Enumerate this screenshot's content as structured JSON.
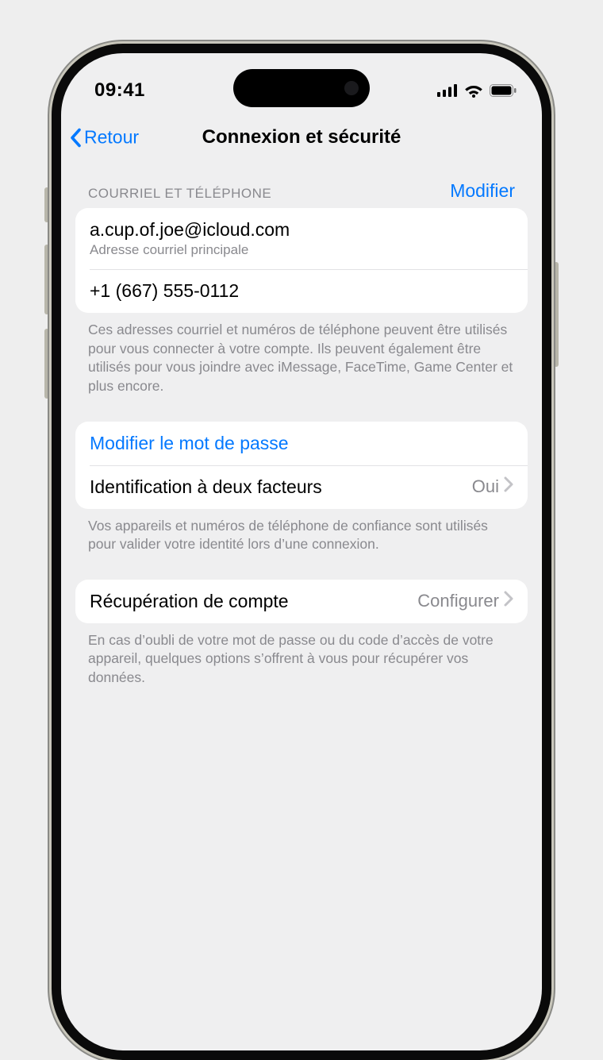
{
  "status": {
    "time": "09:41"
  },
  "nav": {
    "back": "Retour",
    "title": "Connexion et sécurité"
  },
  "section1": {
    "header": "COURRIEL ET TÉLÉPHONE",
    "edit": "Modifier",
    "email": "a.cup.of.joe@icloud.com",
    "email_sub": "Adresse courriel principale",
    "phone": "+1 (667) 555-0112",
    "footer": "Ces adresses courriel et numéros de téléphone peuvent être utilisés pour vous connecter à votre compte. Ils peuvent également être utilisés pour vous joindre avec iMessage, FaceTime, Game Center et plus encore."
  },
  "section2": {
    "change_pw": "Modifier le mot de passe",
    "two_factor": "Identification à deux facteurs",
    "two_factor_value": "Oui",
    "footer": "Vos appareils et numéros de téléphone de confiance sont utilisés pour valider votre identité lors d’une connexion."
  },
  "section3": {
    "recovery": "Récupération de compte",
    "recovery_value": "Configurer",
    "footer": "En cas d’oubli de votre mot de passe ou du code d’accès de votre appareil, quelques options s’offrent à vous pour récupérer vos données."
  }
}
